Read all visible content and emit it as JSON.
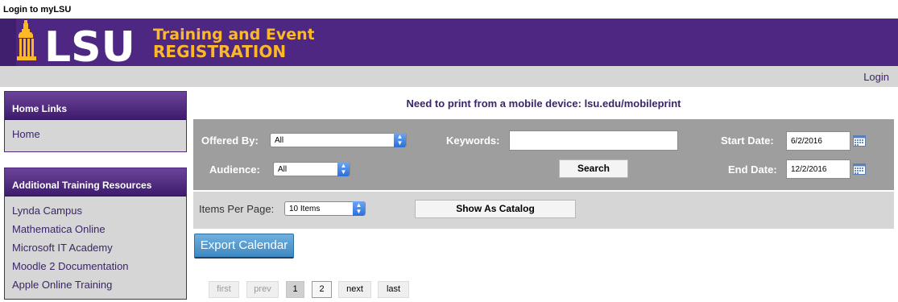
{
  "top_link": "Login to myLSU",
  "banner": {
    "logo_text": "LSU",
    "title_line1": "Training and Event",
    "title_line2": "REGISTRATION",
    "colors": {
      "purple": "#4e2783",
      "gold": "#fdb827"
    }
  },
  "header_bar": {
    "login_label": "Login"
  },
  "sidebar": {
    "home_links": {
      "title": "Home Links",
      "items": [
        {
          "label": "Home"
        }
      ]
    },
    "resources": {
      "title": "Additional Training Resources",
      "items": [
        {
          "label": "Lynda Campus"
        },
        {
          "label": "Mathematica Online"
        },
        {
          "label": "Microsoft IT Academy"
        },
        {
          "label": "Moodle 2 Documentation"
        },
        {
          "label": "Apple Online Training"
        }
      ]
    }
  },
  "notice": "Need to print from a mobile device: lsu.edu/mobileprint",
  "filters": {
    "offered_by": {
      "label": "Offered By:",
      "value": "All"
    },
    "audience": {
      "label": "Audience:",
      "value": "All"
    },
    "keywords": {
      "label": "Keywords:",
      "value": ""
    },
    "search_label": "Search",
    "start_date": {
      "label": "Start Date:",
      "value": "6/2/2016"
    },
    "end_date": {
      "label": "End Date:",
      "value": "12/2/2016"
    }
  },
  "pagination_bar": {
    "items_per_page_label": "Items Per Page:",
    "items_per_page_value": "10 Items",
    "show_catalog_label": "Show As Catalog"
  },
  "export_label": "Export Calendar",
  "pager": {
    "first": "first",
    "prev": "prev",
    "pages": [
      "1",
      "2"
    ],
    "next": "next",
    "last": "last"
  }
}
